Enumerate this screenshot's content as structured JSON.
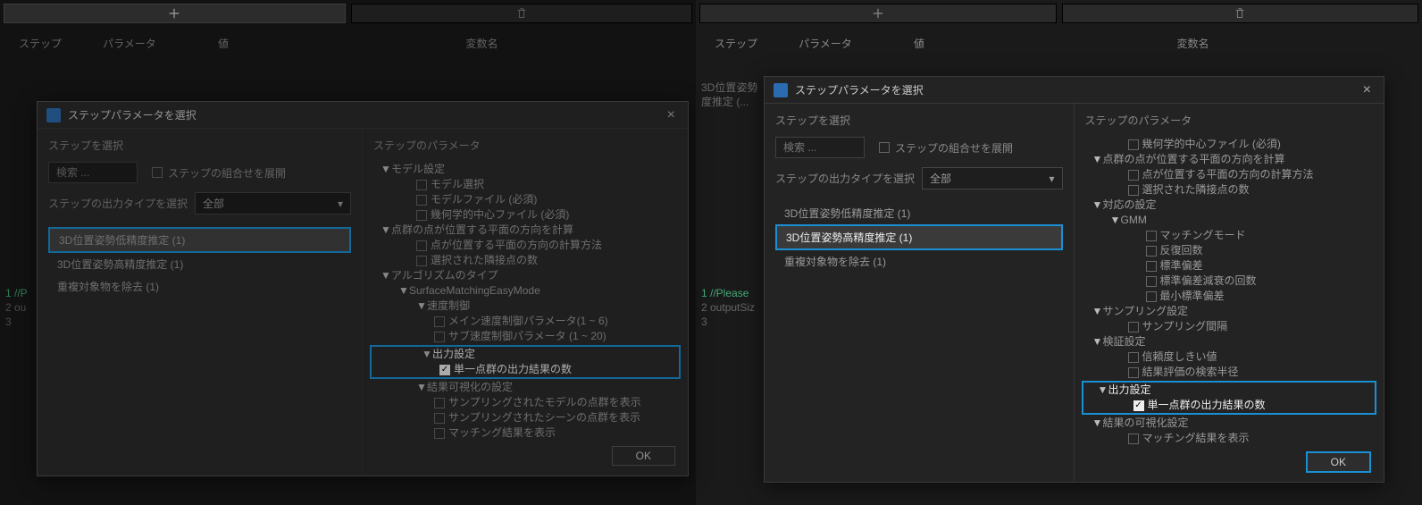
{
  "toolbar": {
    "add_icon": "plus-icon",
    "delete_icon": "trash-icon"
  },
  "columns": {
    "step": "ステップ",
    "parameter": "パラメータ",
    "value": "値",
    "variable": "変数名"
  },
  "background_left": {
    "lines": [
      "1 //P",
      "2 ou",
      "3"
    ]
  },
  "background_right": {
    "breadcrumb": [
      "3D位置姿勢",
      "度推定 (..."
    ],
    "lines": [
      "1 //Please",
      "2 outputSiz",
      "3"
    ]
  },
  "dialog": {
    "title": "ステップパラメータを選択",
    "close": "×",
    "select_step_heading": "ステップを選択",
    "step_params_heading": "ステップのパラメータ",
    "search_placeholder": "検索 ...",
    "expand_combo_label": "ステップの組合せを展開",
    "output_type_label": "ステップの出力タイプを選択",
    "output_type_value": "全部",
    "ok": "OK"
  },
  "left_dialog": {
    "steps": [
      "3D位置姿勢低精度推定 (1)",
      "3D位置姿勢高精度推定 (1)",
      "重複対象物を除去 (1)"
    ],
    "tree": {
      "n0": "モデル設定",
      "n0_0": "モデル選択",
      "n0_1": "モデルファイル (必須)",
      "n0_2": "幾何学的中心ファイル (必須)",
      "n1": "点群の点が位置する平面の方向を計算",
      "n1_0": "点が位置する平面の方向の計算方法",
      "n1_1": "選択された隣接点の数",
      "n2": "アルゴリズムのタイプ",
      "n2_0": "SurfaceMatchingEasyMode",
      "n2_0_0": "速度制御",
      "n2_0_0_0": "メイン速度制御パラメータ(1 ~ 6)",
      "n2_0_0_1": "サブ速度制御パラメータ (1 ~ 20)",
      "n2_0_1": "出力設定",
      "n2_0_1_0": "単一点群の出力結果の数",
      "n2_0_2": "結果可視化の設定",
      "n2_0_2_0": "サンプリングされたモデルの点群を表示",
      "n2_0_2_1": "サンプリングされたシーンの点群を表示",
      "n2_0_2_2": "マッチング結果を表示"
    }
  },
  "right_dialog": {
    "steps": [
      "3D位置姿勢低精度推定 (1)",
      "3D位置姿勢高精度推定 (1)",
      "重複対象物を除去 (1)"
    ],
    "tree": {
      "p0": "幾何学的中心ファイル (必須)",
      "n1": "点群の点が位置する平面の方向を計算",
      "n1_0": "点が位置する平面の方向の計算方法",
      "n1_1": "選択された隣接点の数",
      "n2": "対応の設定",
      "n2_0": "GMM",
      "n2_0_0": "マッチングモード",
      "n2_0_1": "反復回数",
      "n2_0_2": "標準偏差",
      "n2_0_3": "標準偏差減衰の回数",
      "n2_0_4": "最小標準偏差",
      "n3": "サンプリング設定",
      "n3_0": "サンプリング間隔",
      "n4": "検証設定",
      "n4_0": "信頼度しきい値",
      "n4_1": "結果評価の検索半径",
      "n5": "出力設定",
      "n5_0": "単一点群の出力結果の数",
      "n6": "結果の可視化設定",
      "n6_0": "マッチング結果を表示"
    }
  }
}
